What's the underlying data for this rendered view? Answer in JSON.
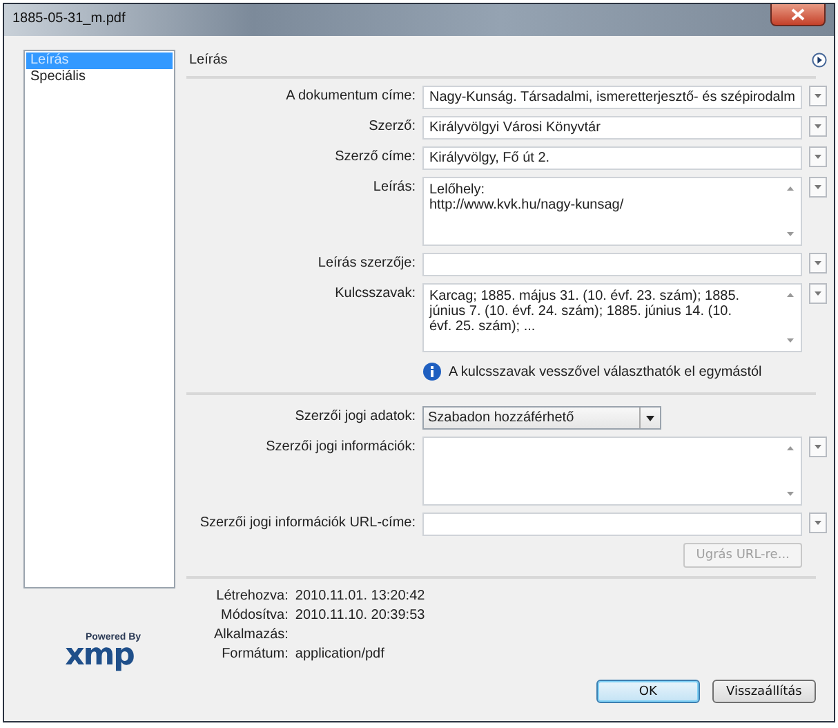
{
  "window": {
    "title": "1885-05-31_m.pdf"
  },
  "sidebar": {
    "items": [
      {
        "label": "Leírás",
        "selected": true
      },
      {
        "label": "Speciális",
        "selected": false
      }
    ]
  },
  "panel": {
    "title": "Leírás"
  },
  "fields": [
    {
      "kind": "text",
      "label": "A dokumentum címe:",
      "value": "Nagy-Kunság. Társadalmi, ismeretterjesztő- és szépirodalm",
      "menu": true
    },
    {
      "kind": "text",
      "label": "Szerző:",
      "value": "Királyvölgyi Városi Könyvtár",
      "menu": true
    },
    {
      "kind": "text",
      "label": "Szerző címe:",
      "value": "Királyvölgy, Fő út 2.",
      "menu": true
    },
    {
      "kind": "textarea",
      "label": "Leírás:",
      "lines": [
        "Lelőhely:",
        "http://www.kvk.hu/nagy-kunsag/"
      ],
      "menu": true
    },
    {
      "kind": "text",
      "label": "Leírás szerzője:",
      "menu": true
    },
    {
      "kind": "textarea",
      "label": "Kulcsszavak:",
      "lines": [
        "Karcag; 1885. május 31. (10. évf. 23. szám); 1885.",
        "június 7. (10. évf. 24. szám); 1885. június 14. (10.",
        "évf. 25. szám); ..."
      ],
      "menu": true
    },
    {
      "kind": "info",
      "text": "A kulcsszavak vesszővel választhatók el egymástól"
    },
    {
      "kind": "divider"
    },
    {
      "kind": "select",
      "label": "Szerzői jogi adatok:",
      "value": "Szabadon hozzáférhető"
    },
    {
      "kind": "textarea",
      "label": "Szerzői jogi információk:",
      "menu": true
    },
    {
      "kind": "text",
      "label": "Szerzői jogi információk URL-címe:",
      "menu": true
    },
    {
      "kind": "button",
      "label": "Ugrás URL-re...",
      "disabled": true
    }
  ],
  "metadata": [
    {
      "label": "Létrehozva:",
      "value": "2010.11.01. 13:20:42"
    },
    {
      "label": "Módosítva:",
      "value": "2010.11.10. 20:39:53"
    },
    {
      "label": "Alkalmazás:"
    },
    {
      "label": "Formátum:",
      "value": "application/pdf"
    }
  ],
  "logo": {
    "tagline": "Powered By",
    "name": "xmp"
  },
  "buttons": [
    {
      "label": "OK",
      "default": true
    },
    {
      "label": "Visszaállítás",
      "default": false
    }
  ]
}
